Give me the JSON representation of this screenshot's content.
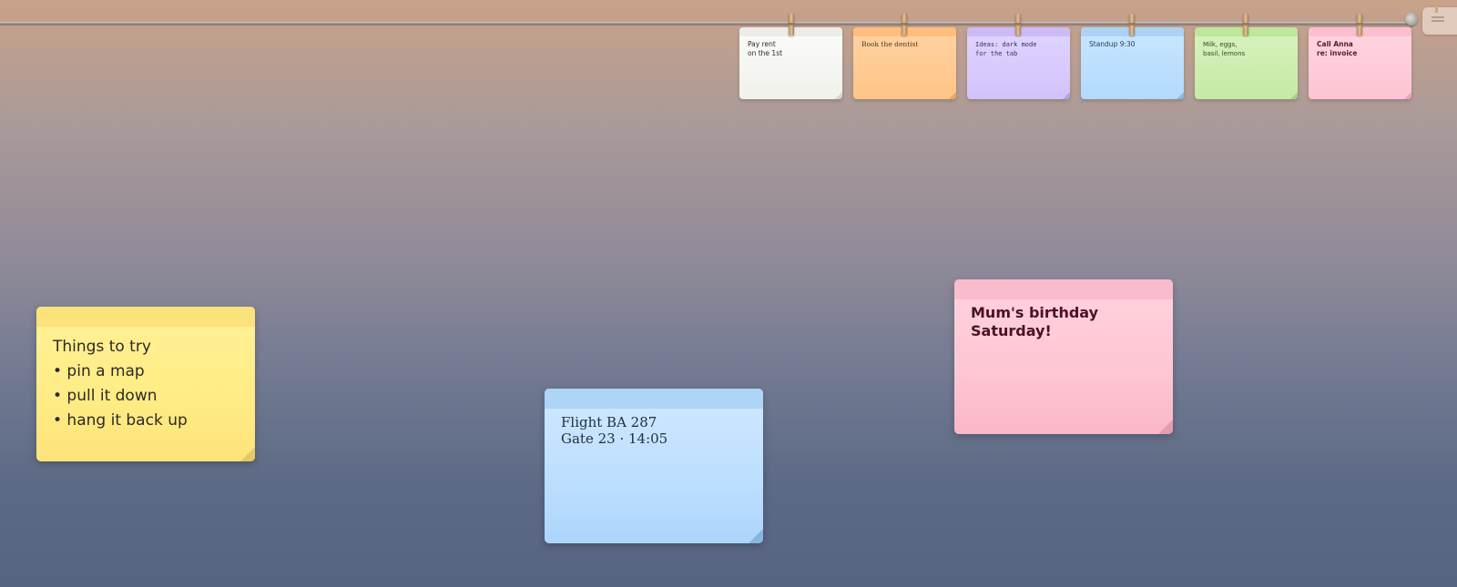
{
  "clothesline": {
    "notes": [
      {
        "id": "rent",
        "text": "Pay rent\non the 1st",
        "color": "#f4f4f0"
      },
      {
        "id": "dentist",
        "text": "Book the dentist",
        "color": "#ffc98f"
      },
      {
        "id": "ideas",
        "text": "Ideas: dark mode\nfor the tab",
        "color": "#d9c9fd"
      },
      {
        "id": "standup",
        "text": "Standup 9:30",
        "color": "#bcdffc"
      },
      {
        "id": "grocery",
        "text": "Milk, eggs,\nbasil, lemons",
        "color": "#cdeeb0"
      },
      {
        "id": "anna",
        "text": "Call Anna\nre: invoice",
        "color": "#ffcad8"
      }
    ]
  },
  "board": {
    "yellow_note": {
      "lines": [
        "Things to try",
        "• pin a map",
        "• pull it down",
        "• hang it back up"
      ],
      "color": "#fff08f"
    },
    "blue_note": {
      "lines": [
        "Flight BA 287",
        "Gate 23 · 14:05"
      ],
      "color": "#c4e3ff"
    },
    "pink_note": {
      "lines": [
        "Mum's birthday",
        "Saturday!"
      ],
      "color": "#ffcbd8"
    }
  }
}
